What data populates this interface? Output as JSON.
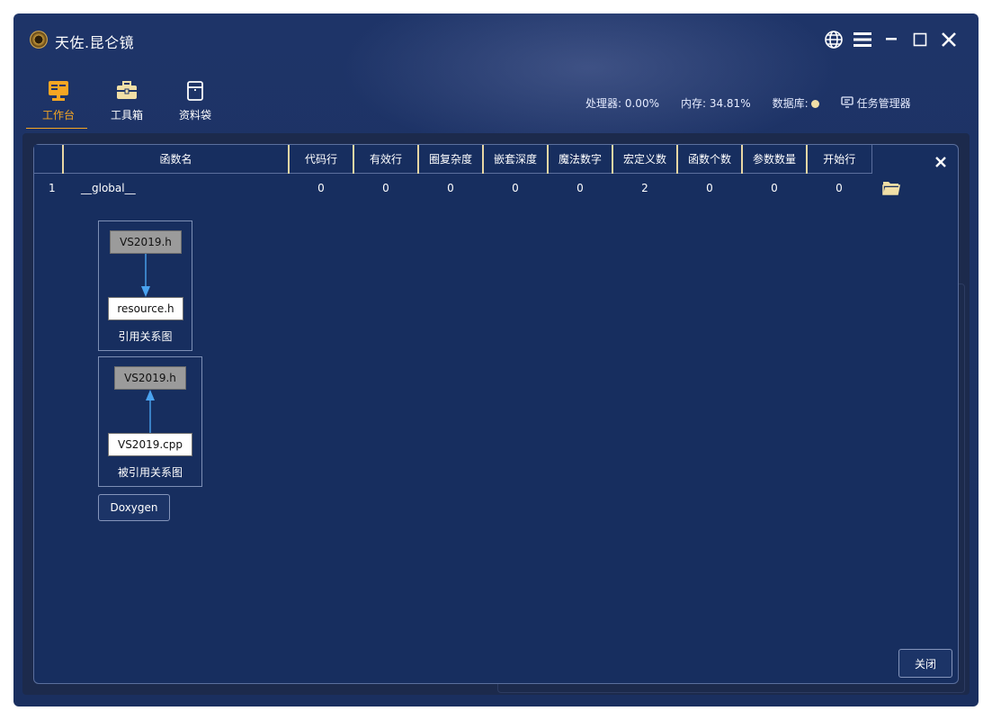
{
  "app": {
    "title": "天佐.昆仑镜"
  },
  "window_controls": [
    {
      "name": "globe-icon"
    },
    {
      "name": "menu-icon"
    },
    {
      "name": "minimize-icon"
    },
    {
      "name": "maximize-icon"
    },
    {
      "name": "close-icon"
    }
  ],
  "nav": {
    "items": [
      {
        "label": "工作台",
        "icon": "workbench-icon",
        "active": true
      },
      {
        "label": "工具箱",
        "icon": "toolbox-icon",
        "active": false
      },
      {
        "label": "资料袋",
        "icon": "data-bag-icon",
        "active": false
      }
    ]
  },
  "stats": {
    "cpu": "处理器: 0.00%",
    "memory": "内存: 34.81%",
    "database": "数据库:",
    "task_manager": "任务管理器"
  },
  "table": {
    "headers": [
      "",
      "函数名",
      "代码行",
      "有效行",
      "圈复杂度",
      "嵌套深度",
      "魔法数字",
      "宏定义数",
      "函数个数",
      "参数数量",
      "开始行"
    ],
    "rows": [
      {
        "idx": "1",
        "name": "__global__",
        "values": [
          "0",
          "0",
          "0",
          "0",
          "0",
          "2",
          "0",
          "0",
          "0"
        ]
      }
    ]
  },
  "graphs": {
    "include": {
      "source": "VS2019.h",
      "target": "resource.h",
      "caption": "引用关系图"
    },
    "included_by": {
      "source": "VS2019.h",
      "target": "VS2019.cpp",
      "caption": "被引用关系图"
    }
  },
  "buttons": {
    "doxygen": "Doxygen",
    "close": "关闭"
  },
  "colors": {
    "accent": "#f5a623",
    "background": "#172e5f",
    "header_divider": "#e8d7a4",
    "arrow": "#4aa3f0"
  }
}
